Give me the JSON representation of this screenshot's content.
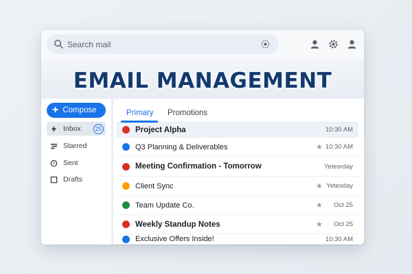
{
  "banner": {
    "title": "EMAIL MANAGEMENT"
  },
  "search": {
    "placeholder": "Search mail"
  },
  "toolbar": {
    "icons": [
      "search-icon",
      "tune-icon",
      "account-icon",
      "settings-icon",
      "profile-icon"
    ]
  },
  "compose": {
    "label": "Compose"
  },
  "sidebar": {
    "items": [
      {
        "label": "Inbox",
        "icon": "inbox-icon",
        "badge": "25",
        "active": true
      },
      {
        "label": "Starred",
        "icon": "starred-icon"
      },
      {
        "label": "Sent",
        "icon": "sent-icon"
      },
      {
        "label": "Drafts",
        "icon": "drafts-icon"
      }
    ]
  },
  "tabs": [
    {
      "label": "Primary",
      "active": true
    },
    {
      "label": "Promotions",
      "active": false
    }
  ],
  "emails": [
    {
      "subject": "Project Alpha",
      "date": "10:30 AM",
      "color": "#d93025",
      "bold": true,
      "starred": false
    },
    {
      "subject": "Q3 Planning & Deliverables",
      "date": "10:30 AM",
      "color": "#1a73e8",
      "bold": false,
      "starred": true
    },
    {
      "subject": "Meeting Confirmation - Tomorrow",
      "date": "Yetesrday",
      "color": "#d93025",
      "bold": true,
      "starred": false
    },
    {
      "subject": "Client Sync",
      "date": "Yetesday",
      "color": "#f9a000",
      "bold": false,
      "starred": true
    },
    {
      "subject": "Team Update Co.",
      "date": "Oct 25",
      "color": "#1e8e3e",
      "bold": false,
      "starred": true
    },
    {
      "subject": "Weekly Standup Notes",
      "date": "Oct 25",
      "color": "#d93025",
      "bold": true,
      "starred": true
    },
    {
      "subject": "Exclusive Offers Inside!",
      "date": "10:30 AM",
      "color": "#1a73e8",
      "bold": false,
      "starred": false
    }
  ],
  "colors": {
    "accent": "#1a73e8",
    "banner_text": "#123a6e"
  }
}
